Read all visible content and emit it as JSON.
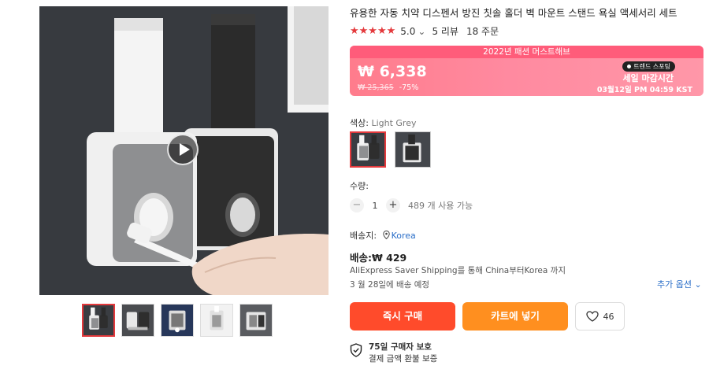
{
  "product": {
    "title": "유용한 자동 치약 디스펜서 방진 칫솔 홀더 벽 마운트 스탠드 욕실 액세서리 세트",
    "stars": "★★★★★",
    "rating": "5.0",
    "rating_chevron": "⌄",
    "reviews": "5 리뷰",
    "orders": "18 주문"
  },
  "price_banner": {
    "event": "2022년 패션 머스트해브",
    "price": "₩ 6,338",
    "original_price": "₩ 25,365",
    "discount": "-75%",
    "trend_badge": "트렌드 스포팅",
    "sale_label": "세일 마감시간",
    "sale_end": "03월12일 PM 04:59 KST",
    "colors": {
      "top": "#ff5c7a",
      "body": "#ff8aa0"
    }
  },
  "color": {
    "label": "색상:",
    "selected": "Light Grey",
    "options": [
      {
        "name": "Light Grey",
        "selected": true
      },
      {
        "name": "Black",
        "selected": false
      }
    ]
  },
  "quantity": {
    "label": "수량:",
    "minus": "−",
    "value": "1",
    "plus": "+",
    "stock": "489 개 사용 가능"
  },
  "shipping": {
    "to_label": "배송지:",
    "location_icon": "location-pin-icon",
    "location": "Korea",
    "cost": "배송:₩ 429",
    "method": "AliExpress Saver Shipping를 통해 China부터Korea 까지",
    "delivery": "3 월 28일에 배송 예정",
    "more_options": "추가 옵션 ⌄"
  },
  "actions": {
    "buy_now": "즉시 구매",
    "add_to_cart": "카트에 넣기",
    "wishlist_count": "46",
    "colors": {
      "buy": "#ff4b2b",
      "cart": "#ff8f1f"
    }
  },
  "protection": {
    "icon": "shield-check-icon",
    "title": "75일 구매자 보호",
    "subtitle": "결제 금액 환불 보증"
  },
  "gallery": {
    "thumbnail_count": 5,
    "active_index": 0
  }
}
